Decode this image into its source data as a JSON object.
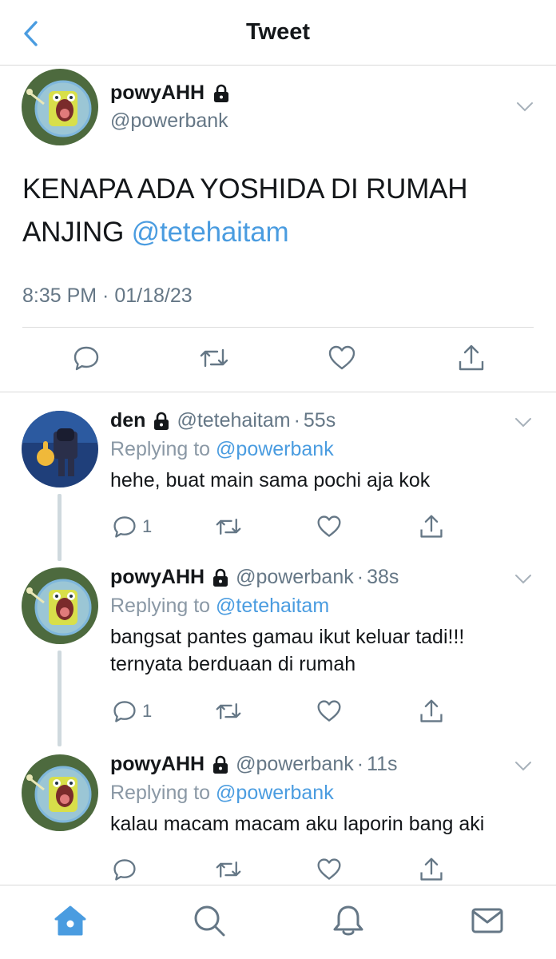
{
  "header": {
    "title": "Tweet"
  },
  "main_tweet": {
    "name": "powyAHH",
    "handle": "@powerbank",
    "text_prefix": "KENAPA ADA YOSHIDA DI RUMAH ANJING ",
    "mention": "@tetehaitam",
    "timestamp": "8:35 PM · 01/18/23"
  },
  "replies": [
    {
      "name": "den",
      "handle": "@tetehaitam",
      "dot": "·",
      "time": "55s",
      "replying_label": "Replying to ",
      "replying_to": "@powerbank",
      "text": "hehe, buat main sama pochi aja kok",
      "reply_count": "1"
    },
    {
      "name": "powyAHH",
      "handle": "@powerbank",
      "dot": "·",
      "time": "38s",
      "replying_label": "Replying to ",
      "replying_to": "@tetehaitam",
      "text": "bangsat pantes gamau ikut keluar tadi!!! ternyata berduaan di rumah",
      "reply_count": "1"
    },
    {
      "name": "powyAHH",
      "handle": "@powerbank",
      "dot": "·",
      "time": "11s",
      "replying_label": "Replying to ",
      "replying_to": "@powerbank",
      "text": "kalau macam macam aku laporin bang aki",
      "reply_count": ""
    }
  ],
  "colors": {
    "accent": "#4a9ce0",
    "secondary_text": "#657786",
    "divider": "#d9d9d9"
  },
  "tabbar": {
    "items": [
      "home-icon",
      "search-icon",
      "notifications-icon",
      "messages-icon"
    ],
    "active": "home-icon"
  }
}
